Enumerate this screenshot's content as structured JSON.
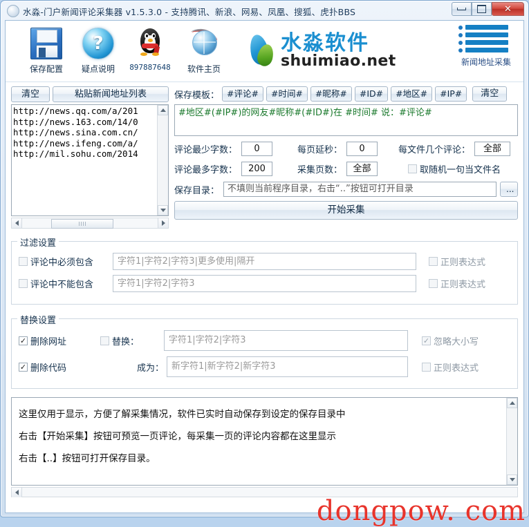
{
  "window": {
    "title": "水淼-门户新闻评论采集器 v1.5.3.0 - 支持腾讯、新浪、网易、凤凰、搜狐、虎扑BBS",
    "minimize_label": "最小化",
    "maximize_label": "最大化",
    "close_label": "✕"
  },
  "toolbar": {
    "items": [
      {
        "icon": "floppy-disk-icon",
        "label": "保存配置"
      },
      {
        "icon": "question-help-icon",
        "label": "疑点说明"
      },
      {
        "icon": "qq-penguin-icon",
        "label": "897887648"
      },
      {
        "icon": "globe-homepage-icon",
        "label": "软件主页"
      }
    ],
    "logo_cn": "水淼软件",
    "logo_en": "shuimiao.net",
    "news_collect_label": "新闻地址采集"
  },
  "url_panel": {
    "clear_button": "清空",
    "paste_button": "粘贴新闻地址列表",
    "urls": [
      "http://news.qq.com/a/201",
      "http://news.163.com/14/0",
      "http://news.sina.com.cn/",
      "http://news.ifeng.com/a/",
      "http://mil.sohu.com/2014"
    ]
  },
  "template_panel": {
    "label": "保存模板：",
    "tags": [
      "#评论#",
      "#时间#",
      "#昵称#",
      "#ID#",
      "#地区#",
      "#IP#"
    ],
    "clear_button": "清空",
    "template_text": "#地区#(#IP#)的网友#昵称#(#ID#)在 #时间# 说：#评论#",
    "template_color": "#1c7a2e"
  },
  "options": {
    "min_words_label": "评论最少字数：",
    "min_words_value": "0",
    "max_words_label": "评论最多字数：",
    "max_words_value": "200",
    "page_delay_label": "每页延秒：",
    "page_delay_value": "0",
    "pages_label": "采集页数：",
    "pages_value": "全部",
    "per_file_label": "每文件几个评论：",
    "per_file_value": "全部",
    "random_name_label": "取随机一句当文件名",
    "random_name_checked": false,
    "save_dir_label": "保存目录：",
    "save_dir_value": "不填则当前程序目录，右击“..”按钮可打开目录",
    "browse_button": "...",
    "start_button": "开始采集"
  },
  "filter_group": {
    "title": "过滤设置",
    "rows": [
      {
        "checkbox_label": "评论中必须包含",
        "checked": false,
        "input_value": "字符1|字符2|字符3|更多使用|隔开",
        "regex_label": "正则表达式",
        "regex_checked": false
      },
      {
        "checkbox_label": "评论中不能包含",
        "checked": false,
        "input_value": "字符1|字符2|字符3",
        "regex_label": "正则表达式",
        "regex_checked": false
      }
    ]
  },
  "replace_group": {
    "title": "替换设置",
    "del_url_label": "删除网址",
    "del_url_checked": true,
    "del_code_label": "删除代码",
    "del_code_checked": true,
    "replace_checkbox_label": "替换：",
    "replace_checked": false,
    "replace_from_value": "字符1|字符2|字符3",
    "replace_to_label": "成为：",
    "replace_to_value": "新字符1|新字符2|新字符3",
    "ignore_case_label": "忽略大小写",
    "ignore_case_checked": true,
    "regex_label": "正则表达式",
    "regex_checked": false
  },
  "log_panel": {
    "lines": [
      "这里仅用于显示，方便了解采集情况，软件已实时自动保存到设定的保存目录中",
      "右击【开始采集】按钮可预览一页评论，每采集一页的评论内容都在这里显示",
      "右击【..】按钮可打开保存目录。"
    ]
  },
  "watermark": "dongpow. com"
}
